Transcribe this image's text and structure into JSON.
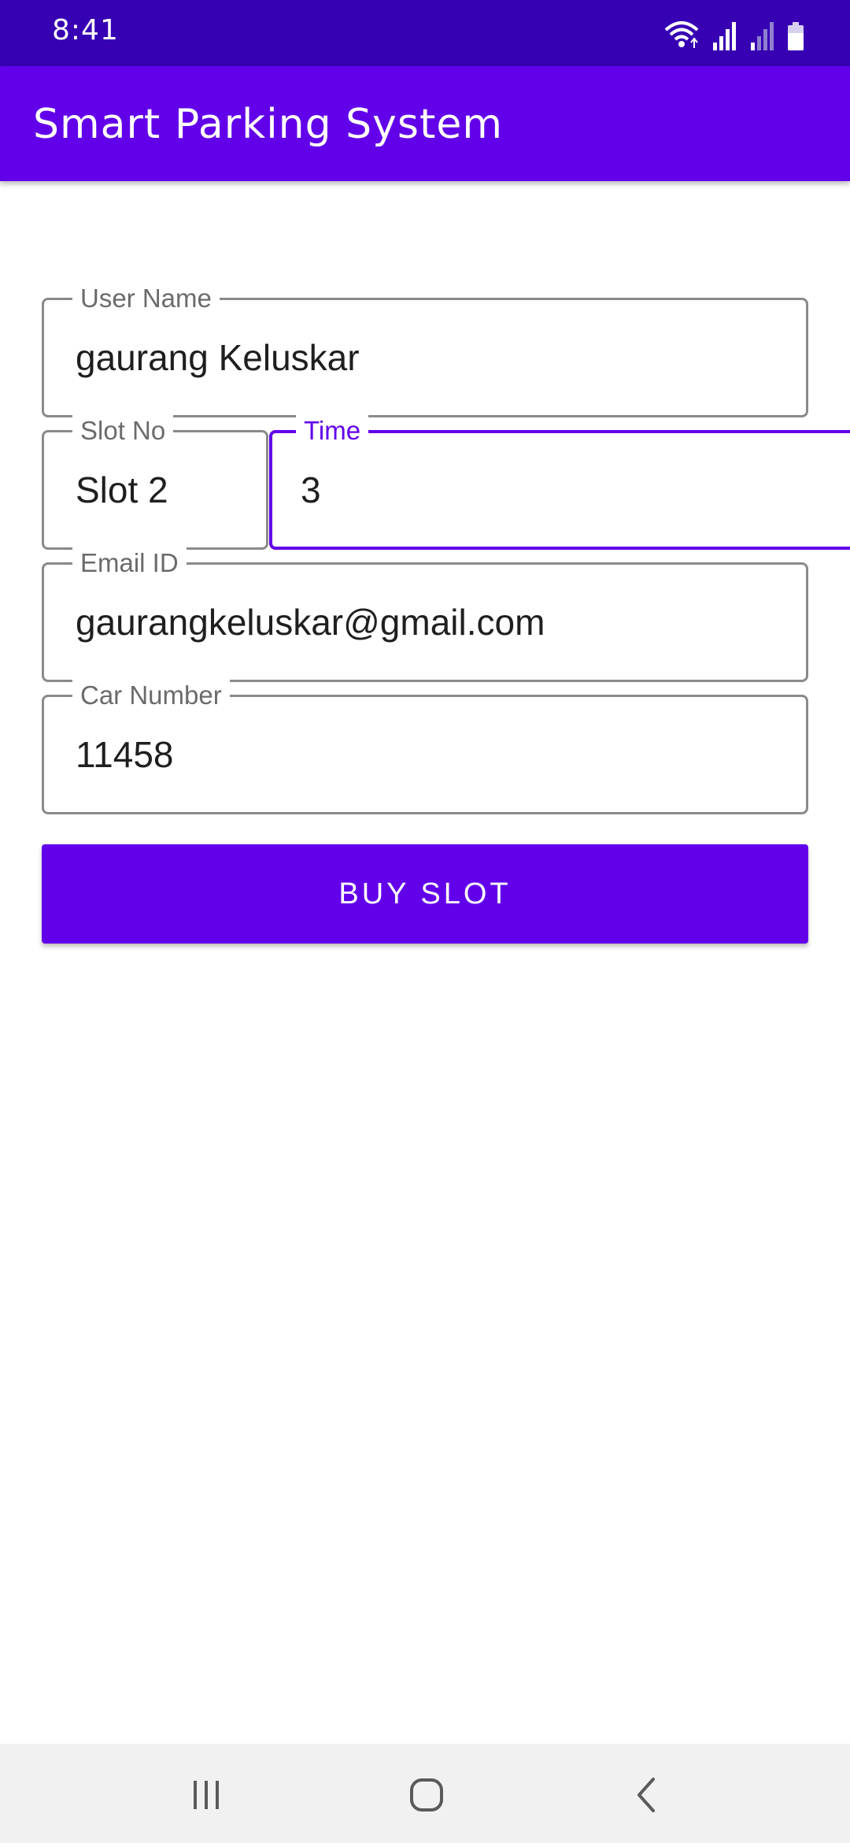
{
  "status_bar": {
    "time": "8:41",
    "icons": [
      "wifi-icon",
      "signal-icon",
      "signal-weak-icon",
      "battery-icon"
    ]
  },
  "app_bar": {
    "title": "Smart Parking System"
  },
  "form": {
    "user_name": {
      "label": "User Name",
      "value": "gaurang Keluskar"
    },
    "slot_no": {
      "label": "Slot No",
      "value": "Slot 2"
    },
    "time": {
      "label": "Time",
      "value": "3"
    },
    "email": {
      "label": "Email ID",
      "value": "gaurangkeluskar@gmail.com"
    },
    "car_number": {
      "label": "Car Number",
      "value": "11458"
    },
    "buy_button": "BUY SLOT"
  },
  "nav_bar": {
    "buttons": [
      "recent-apps-icon",
      "home-icon",
      "back-icon"
    ]
  },
  "colors": {
    "status_bar": "#3700b3",
    "primary": "#6200ea",
    "field_border": "#8a8a8a",
    "nav_bar": "#f1f1f1"
  }
}
